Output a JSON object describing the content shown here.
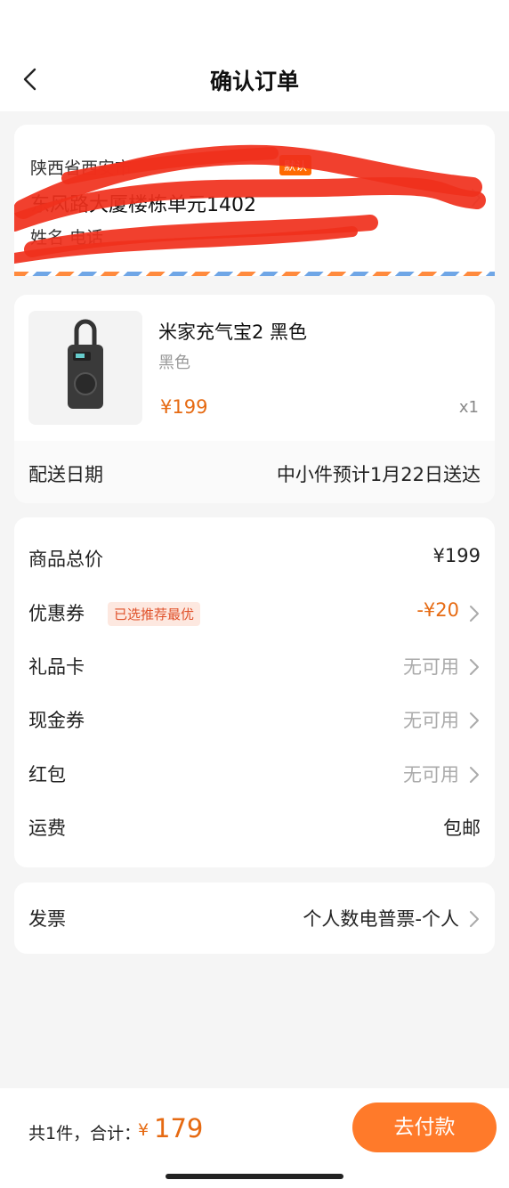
{
  "header": {
    "title": "确认订单",
    "back_icon": "chevron-left-icon"
  },
  "address": {
    "line1": "陕西省西安市",
    "default_tag": "默认",
    "line2": "东风路大厦楼栋单元1402",
    "line3": "姓名 电话"
  },
  "product": {
    "name": "米家充气宝2 黑色",
    "variant": "黑色",
    "price": "¥199",
    "quantity": "x1"
  },
  "delivery": {
    "label": "配送日期",
    "value": "中小件预计1月22日送达"
  },
  "price_breakdown": {
    "subtotal_label": "商品总价",
    "subtotal_value": "¥199",
    "coupon_label": "优惠券",
    "coupon_tag": "已选推荐最优",
    "coupon_value": "-¥20",
    "giftcard_label": "礼品卡",
    "giftcard_value": "无可用",
    "cashcoupon_label": "现金券",
    "cashcoupon_value": "无可用",
    "redpacket_label": "红包",
    "redpacket_value": "无可用",
    "shipping_label": "运费",
    "shipping_value": "包邮"
  },
  "invoice": {
    "label": "发票",
    "value": "个人数电普票-个人"
  },
  "footer": {
    "total_label": "共1件，合计：",
    "currency": "¥",
    "total_amount": "179",
    "pay_button": "去付款"
  },
  "colors": {
    "accent": "#ff7a2a",
    "price": "#e66a12",
    "background": "#f5f5f5"
  }
}
